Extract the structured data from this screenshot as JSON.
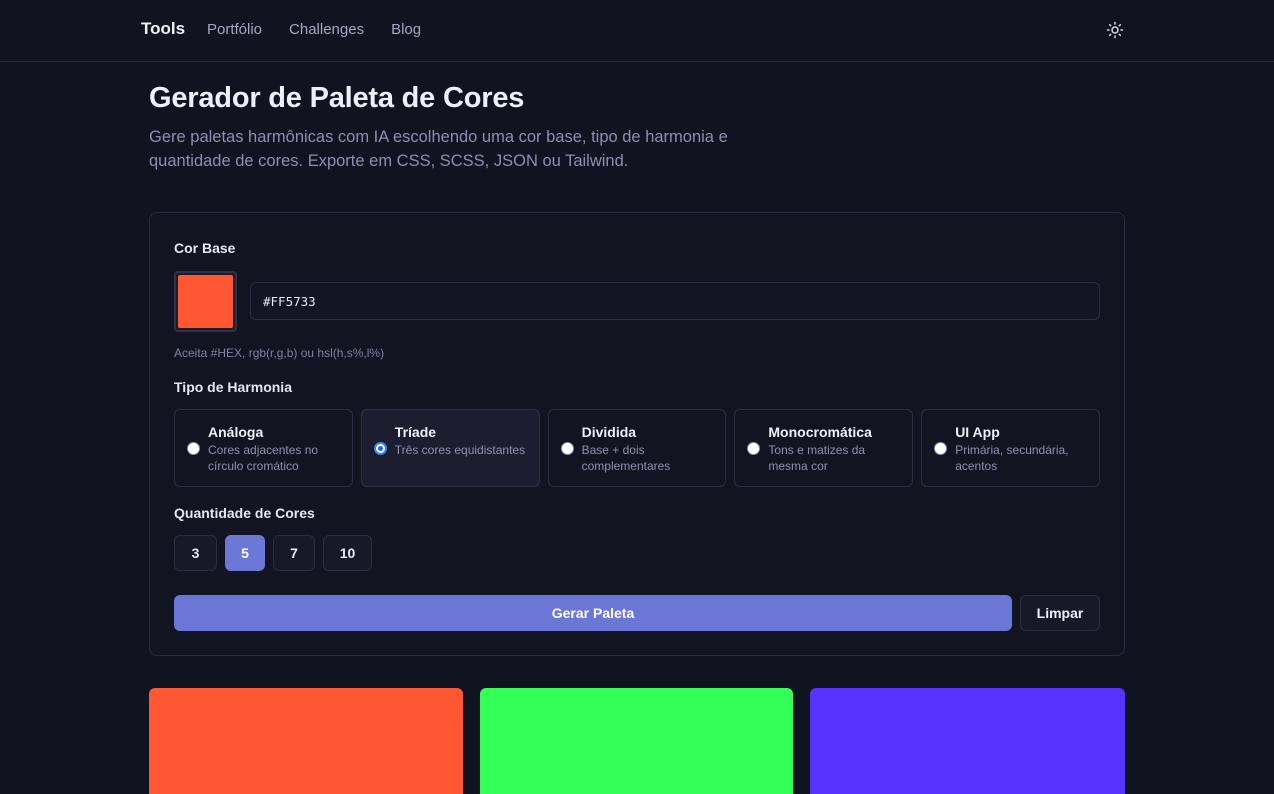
{
  "nav": {
    "brand": "Tools",
    "links": [
      "Portfólio",
      "Challenges",
      "Blog"
    ],
    "theme_icon": "sun-icon"
  },
  "header": {
    "title": "Gerador de Paleta de Cores",
    "subtitle": "Gere paletas harmônicas com IA escolhendo uma cor base, tipo de harmonia e quantidade de cores. Exporte em CSS, SCSS, JSON ou Tailwind."
  },
  "form": {
    "base_label": "Cor Base",
    "base_color": "#FF5733",
    "base_value": "#FF5733",
    "hint": "Aceita #HEX, rgb(r,g,b) ou hsl(h,s%,l%)",
    "harmony_label": "Tipo de Harmonia",
    "harmonies": [
      {
        "name": "Análoga",
        "desc": "Cores adjacentes no círculo cromático",
        "selected": false
      },
      {
        "name": "Tríade",
        "desc": "Três cores equidistantes",
        "selected": true
      },
      {
        "name": "Dividida",
        "desc": "Base + dois complementares",
        "selected": false
      },
      {
        "name": "Monocromática",
        "desc": "Tons e matizes da mesma cor",
        "selected": false
      },
      {
        "name": "UI App",
        "desc": "Primária, secundária, acentos",
        "selected": false
      }
    ],
    "quantity_label": "Quantidade de Cores",
    "quantities": [
      "3",
      "5",
      "7",
      "10"
    ],
    "selected_quantity": "5",
    "generate_label": "Gerar Paleta",
    "clear_label": "Limpar"
  },
  "palette": [
    "#FF5733",
    "#33FF57",
    "#5733FF"
  ],
  "colors": {
    "accent": "#6B77D6",
    "background": "#121320"
  }
}
